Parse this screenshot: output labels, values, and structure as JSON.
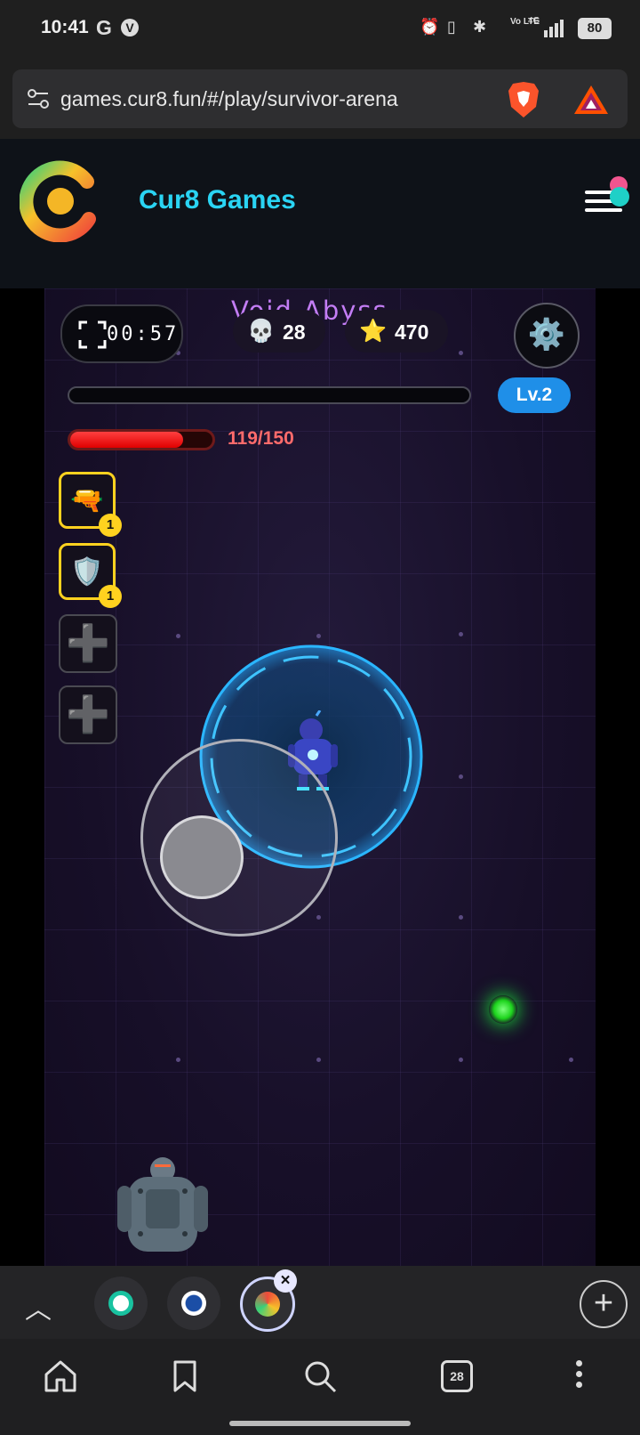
{
  "status_bar": {
    "time": "10:41",
    "network": "Vo LTE",
    "signal": "4G",
    "battery": "80",
    "icons": [
      "google-icon",
      "vpn-icon",
      "alarm-icon",
      "vibrate-icon",
      "bluetooth-icon",
      "signal-icon",
      "battery-icon"
    ]
  },
  "browser": {
    "url": "games.cur8.fun/#/play/survivor-arena",
    "extensions": [
      "brave-shields-icon",
      "brave-rewards-icon"
    ]
  },
  "site": {
    "brand": "Cur8 Games"
  },
  "game": {
    "timer": "00:57",
    "map_name": "Void Abyss",
    "kills": "28",
    "score": "470",
    "level": "Lv.2",
    "xp_fraction": 0,
    "hp_text": "119/150",
    "hp_fraction": 0.793,
    "weapon_slots": [
      {
        "icon": "🔫",
        "level": "1"
      },
      {
        "icon": "🛡️",
        "level": "1"
      }
    ],
    "empty_slot_icon": "➕",
    "kills_icon": "💀",
    "score_icon": "⭐",
    "settings_icon": "⚙️"
  },
  "tabs": {
    "tab_count": "28"
  },
  "colors": {
    "brand": "#2ad4f3",
    "level_badge": "#1f8fe8",
    "hp": "#ff1f1f",
    "map_name": "#c37df5",
    "slot_border": "#ffd21f"
  }
}
